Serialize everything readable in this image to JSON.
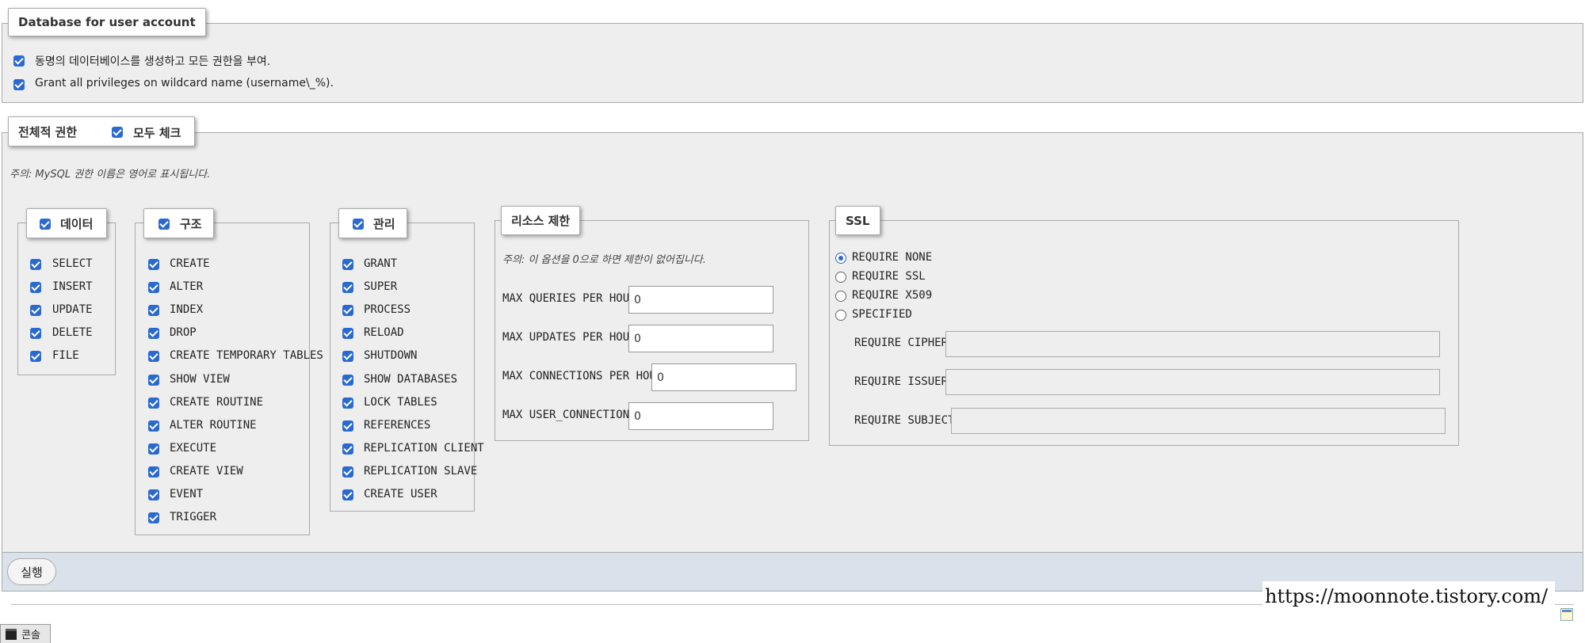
{
  "db_user": {
    "legend": "Database for user account",
    "option1": "동명의 데이터베이스를 생성하고 모든 권한을 부여.",
    "option2": "Grant all privileges on wildcard name (username\\_%)."
  },
  "global": {
    "legend": "전체적 권한",
    "check_all": "모두 체크",
    "note": "주의: MySQL 권한 이름은 영어로 표시됩니다."
  },
  "data_group": {
    "title": "데이터",
    "items": [
      "SELECT",
      "INSERT",
      "UPDATE",
      "DELETE",
      "FILE"
    ]
  },
  "structure_group": {
    "title": "구조",
    "items": [
      "CREATE",
      "ALTER",
      "INDEX",
      "DROP",
      "CREATE TEMPORARY TABLES",
      "SHOW VIEW",
      "CREATE ROUTINE",
      "ALTER ROUTINE",
      "EXECUTE",
      "CREATE VIEW",
      "EVENT",
      "TRIGGER"
    ]
  },
  "admin_group": {
    "title": "관리",
    "items": [
      "GRANT",
      "SUPER",
      "PROCESS",
      "RELOAD",
      "SHUTDOWN",
      "SHOW DATABASES",
      "LOCK TABLES",
      "REFERENCES",
      "REPLICATION CLIENT",
      "REPLICATION SLAVE",
      "CREATE USER"
    ]
  },
  "resource": {
    "title": "리소스 제한",
    "note": "주의: 이 옵션을 0으로 하면 제한이 없어집니다.",
    "max_queries_label": "MAX QUERIES PER HOUR",
    "max_queries_value": "0",
    "max_updates_label": "MAX UPDATES PER HOUR",
    "max_updates_value": "0",
    "max_connections_label": "MAX CONNECTIONS PER HOUR",
    "max_connections_value": "0",
    "max_user_conn_label": "MAX USER_CONNECTIONS",
    "max_user_conn_value": "0"
  },
  "ssl": {
    "title": "SSL",
    "options": [
      "REQUIRE NONE",
      "REQUIRE SSL",
      "REQUIRE X509",
      "SPECIFIED"
    ],
    "selected": "REQUIRE NONE",
    "cipher_label": "REQUIRE CIPHER",
    "issuer_label": "REQUIRE ISSUER",
    "subject_label": "REQUIRE SUBJECT"
  },
  "footer": {
    "submit": "실행",
    "watermark": "https://moonnote.tistory.com/",
    "console": "콘솔"
  },
  "colors": {
    "checkbox": "#2a6ad0",
    "panel": "#eeeeee",
    "footer_bar": "#d9e2ea"
  }
}
